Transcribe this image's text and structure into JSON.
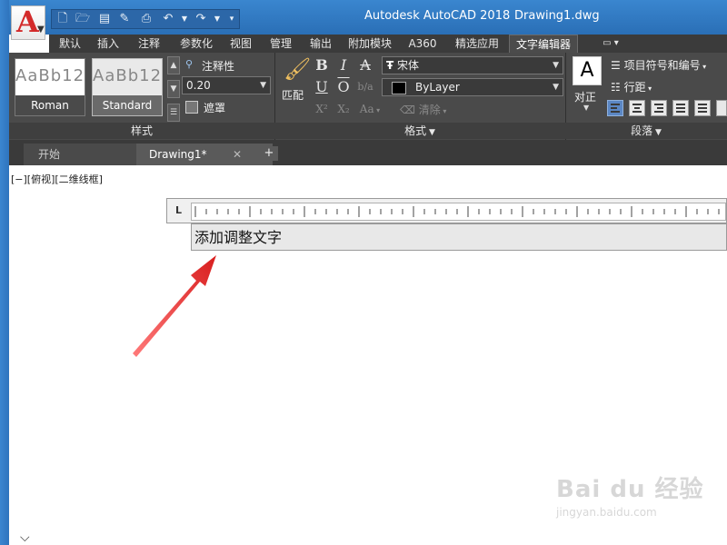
{
  "window": {
    "title": "Autodesk AutoCAD 2018",
    "document": "Drawing1.dwg"
  },
  "app_button": {
    "letter": "A"
  },
  "ribbon_tabs": [
    {
      "label": "默认"
    },
    {
      "label": "插入"
    },
    {
      "label": "注释"
    },
    {
      "label": "参数化"
    },
    {
      "label": "视图"
    },
    {
      "label": "管理"
    },
    {
      "label": "输出"
    },
    {
      "label": "附加模块"
    },
    {
      "label": "A360"
    },
    {
      "label": "精选应用"
    },
    {
      "label": "文字编辑器",
      "active": true
    }
  ],
  "style_panel": {
    "tiles": [
      {
        "preview": "AaBb12",
        "name": "Roman"
      },
      {
        "preview": "AaBb12",
        "name": "Standard",
        "selected": true
      }
    ],
    "annotative_label": "注释性",
    "height_value": "0.20",
    "mask_label": "遮罩",
    "footer": "样式"
  },
  "format_panel": {
    "match_label": "匹配",
    "bold": "B",
    "italic": "I",
    "strike": "A",
    "underline": "U",
    "overline": "O",
    "stack": "b/a",
    "superscript": "X²",
    "subscript": "X₂",
    "case": "Aa",
    "clear_label": "清除",
    "font": "宋体",
    "color": "ByLayer",
    "footer": "格式"
  },
  "paragraph_panel": {
    "justify_label": "对正",
    "bullets_label": "项目符号和编号",
    "line_spacing_label": "行距",
    "footer": "段落"
  },
  "doc_tabs": [
    {
      "label": "开始"
    },
    {
      "label": "Drawing1*",
      "active": true
    }
  ],
  "viewport_label": "[−][俯视][二维线框]",
  "ruler_label": "L",
  "editor_text": "添加调整文字",
  "watermark": {
    "brand": "Bai du 经验",
    "url": "jingyan.baidu.com"
  },
  "colors": {
    "title_bar": "#2f75bf",
    "ribbon": "#4a4a4a",
    "arrow": "#e52b2b",
    "active_paragraph_button": "#5b87c4"
  }
}
